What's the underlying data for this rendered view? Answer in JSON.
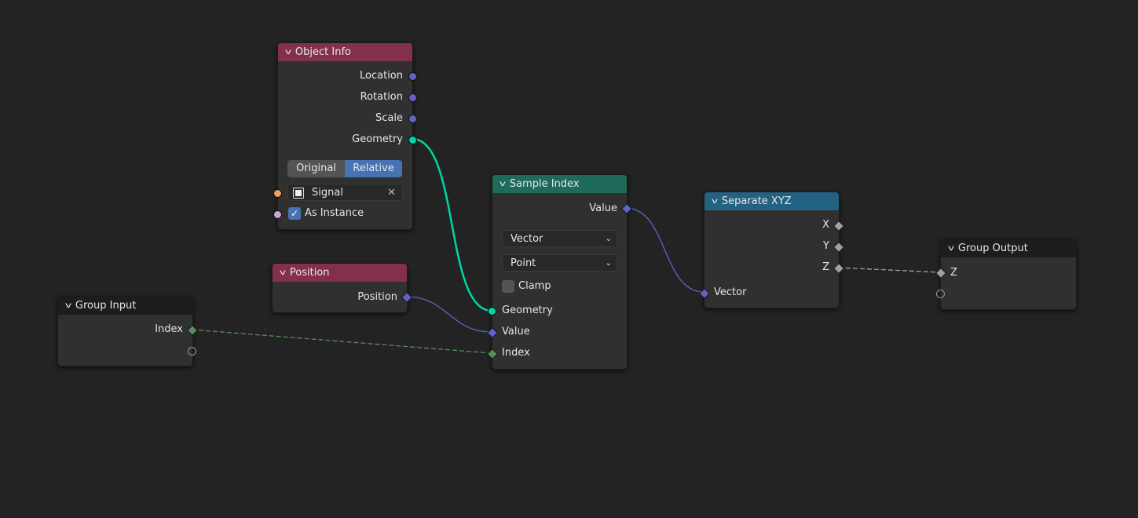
{
  "nodes": {
    "object_info": {
      "title": "Object Info",
      "outputs": [
        "Location",
        "Rotation",
        "Scale",
        "Geometry"
      ],
      "transform_options": [
        "Original",
        "Relative"
      ],
      "selected_transform": "Relative",
      "object_field": "Signal",
      "as_instance_label": "As Instance",
      "as_instance_checked": true,
      "header_color": "#83314a"
    },
    "position": {
      "title": "Position",
      "output": "Position",
      "header_color": "#83314a"
    },
    "group_input": {
      "title": "Group Input",
      "output": "Index",
      "header_color": "#1d1d1d"
    },
    "sample_index": {
      "title": "Sample Index",
      "output": "Value",
      "data_type": "Vector",
      "domain": "Point",
      "clamp_label": "Clamp",
      "clamp_checked": false,
      "inputs": [
        "Geometry",
        "Value",
        "Index"
      ],
      "header_color": "#1e6b5a"
    },
    "separate_xyz": {
      "title": "Separate XYZ",
      "outputs": [
        "X",
        "Y",
        "Z"
      ],
      "input": "Vector",
      "header_color": "#246283"
    },
    "group_output": {
      "title": "Group Output",
      "input": "Z",
      "header_color": "#1d1d1d"
    }
  },
  "colors": {
    "geometry": "#00d6a3",
    "vector": "#6363c7",
    "integer": "#598c5c",
    "float": "#a1a1a1",
    "object": "#ed9e5c",
    "boolean": "#cca6d6"
  }
}
